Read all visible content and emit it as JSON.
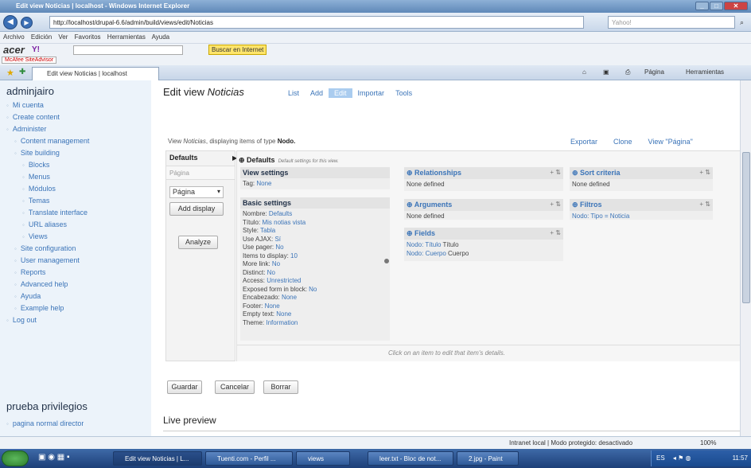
{
  "window": {
    "title": "Edit view Noticias | localhost - Windows Internet Explorer"
  },
  "browser": {
    "address": "http://localhost/drupal-6.6/admin/build/views/edit/Noticias",
    "search_placeholder": "Yahoo!",
    "menu": [
      "Archivo",
      "Edición",
      "Ver",
      "Favoritos",
      "Herramientas",
      "Ayuda"
    ],
    "toolbar_brand": "acer",
    "search_button": "Buscar en Internet",
    "mcafee": "McAfee SiteAdvisor",
    "tab_label": "Edit view Noticias | localhost",
    "page_menu": "Página",
    "tools_menu": "Herramientas"
  },
  "sidebar": {
    "user": "adminjairo",
    "items": [
      "Mi cuenta",
      "Create content",
      "Administer",
      "Content management",
      "Site building",
      "Blocks",
      "Menus",
      "Módulos",
      "Temas",
      "Translate interface",
      "URL aliases",
      "Views",
      "Site configuration",
      "User management",
      "Reports",
      "Advanced help",
      "Ayuda",
      "Example help",
      "Log out"
    ],
    "block2_title": "prueba privilegios",
    "block2_items": [
      "pagina normal director"
    ]
  },
  "main": {
    "title_prefix": "Edit view ",
    "title_name": "Noticias",
    "tabs": [
      "List",
      "Add",
      "Edit",
      "Importar",
      "Tools"
    ],
    "desc_prefix": "View ",
    "desc_name": "Noticias",
    "desc_mid": ", displaying items of type ",
    "desc_type": "Nodo.",
    "view_links": [
      "Exportar",
      "Clone",
      "View \"Página\""
    ],
    "left": {
      "defaults": "Defaults",
      "pagina": "Página",
      "select_value": "Página",
      "add_display": "Add display",
      "analyze": "Analyze"
    },
    "panel": {
      "title": "Defaults",
      "subtitle": "Default settings for this view.",
      "view_settings": {
        "head": "View settings",
        "tag_label": "Tag: ",
        "tag_value": "None"
      },
      "basic_settings": {
        "head": "Basic settings",
        "rows": [
          [
            "Nombre: ",
            "Defaults"
          ],
          [
            "Título: ",
            "Mis notias vista"
          ],
          [
            "Style: ",
            "Tabla"
          ],
          [
            "Use AJAX: ",
            "Sí"
          ],
          [
            "Use pager: ",
            "No"
          ],
          [
            "Items to display: ",
            "10"
          ],
          [
            "More link: ",
            "No"
          ],
          [
            "Distinct: ",
            "No"
          ],
          [
            "Access: ",
            "Unrestricted"
          ],
          [
            "Exposed form in block: ",
            "No"
          ],
          [
            "Encabezado: ",
            "None"
          ],
          [
            "Footer: ",
            "None"
          ],
          [
            "Empty text: ",
            "None"
          ],
          [
            "Theme: ",
            "Information"
          ]
        ]
      },
      "relationships": {
        "head": "Relationships",
        "body": "None defined"
      },
      "arguments": {
        "head": "Arguments",
        "body": "None defined"
      },
      "fields": {
        "head": "Fields",
        "rows": [
          [
            "Nodo: Título",
            " Título"
          ],
          [
            "Nodo: Cuerpo",
            " Cuerpo"
          ]
        ]
      },
      "sort": {
        "head": "Sort criteria",
        "body": "None defined"
      },
      "filters": {
        "head": "Filtros",
        "body": "Nodo: Tipo = Noticia"
      },
      "hint": "Click on an item to edit that item's details."
    },
    "buttons": [
      "Guardar",
      "Cancelar",
      "Borrar"
    ],
    "preview": "Live preview"
  },
  "statusbar": {
    "zone": "Intranet local | Modo protegido: desactivado",
    "zoom": "100%"
  },
  "taskbar": {
    "items": [
      "Edit view Noticias | L...",
      "Tuenti.com - Perfil ...",
      "views",
      "leer.txt - Bloc de not...",
      "2.jpg - Paint"
    ],
    "lang": "ES",
    "time": "11:57"
  }
}
